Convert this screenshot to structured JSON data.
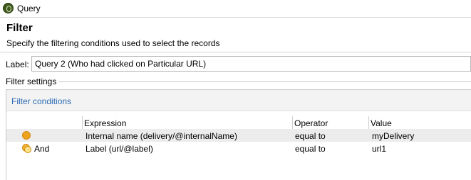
{
  "window": {
    "title": "Query",
    "app_icon": "app-logo-icon"
  },
  "header": {
    "title": "Filter",
    "subtitle": "Specify the filtering conditions used to select the records"
  },
  "label_field": {
    "caption": "Label:",
    "value": "Query 2 (Who had clicked on Particular URL)"
  },
  "filter_settings": {
    "caption": "Filter settings",
    "panel_title": "Filter conditions",
    "columns": {
      "expression": "Expression",
      "operator": "Operator",
      "value": "Value"
    },
    "rows": [
      {
        "icon": "condition-dot-icon",
        "logic": "",
        "expression": "Internal name (delivery/@internalName)",
        "operator": "equal to",
        "value": "myDelivery",
        "selected": true
      },
      {
        "icon": "and-condition-icon",
        "logic": "And",
        "expression": "Label (url/@label)",
        "operator": "equal to",
        "value": "url1",
        "selected": false
      }
    ]
  },
  "colors": {
    "link": "#2a6ab3",
    "condition_icon": "#eea31f",
    "selected_row": "#ececec"
  }
}
